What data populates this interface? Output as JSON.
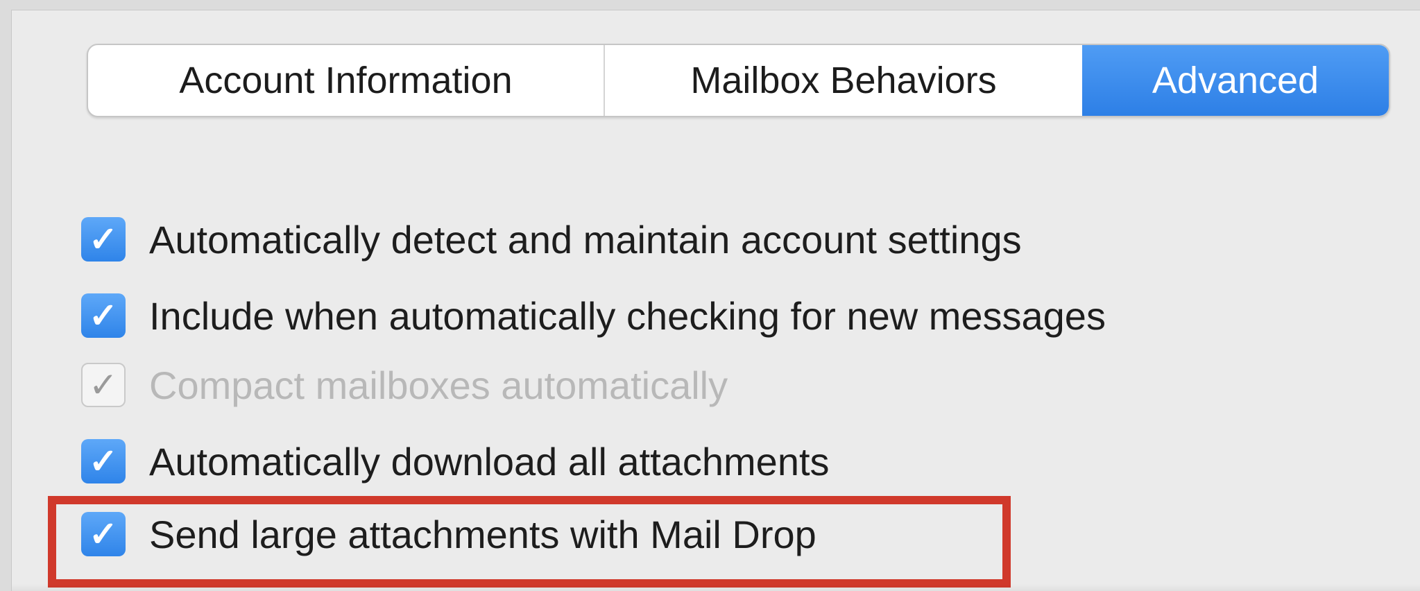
{
  "tabs": [
    {
      "label": "Account Information",
      "selected": false
    },
    {
      "label": "Mailbox Behaviors",
      "selected": false
    },
    {
      "label": "Advanced",
      "selected": true
    }
  ],
  "options": [
    {
      "label": "Automatically detect and maintain account settings",
      "checked": true,
      "enabled": true
    },
    {
      "label": "Include when automatically checking for new messages",
      "checked": true,
      "enabled": true
    },
    {
      "label": "Compact mailboxes automatically",
      "checked": true,
      "enabled": false
    },
    {
      "label": "Automatically download all attachments",
      "checked": true,
      "enabled": true
    },
    {
      "label": "Send large attachments with Mail Drop",
      "checked": true,
      "enabled": true
    }
  ],
  "checkmark_glyph": "✓",
  "colors": {
    "accent": "#2f84e9",
    "highlight": "#d0392b"
  }
}
